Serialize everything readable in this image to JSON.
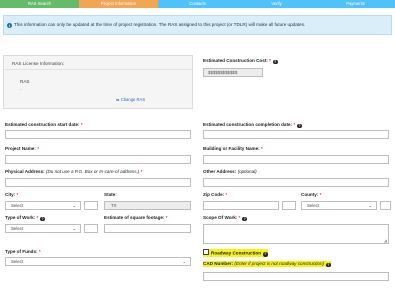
{
  "steps": [
    {
      "label": "RAS Search",
      "color": "#66bb6a"
    },
    {
      "label": "Project Information",
      "color": "#f2a653"
    },
    {
      "label": "Contacts",
      "color": "#4fc3f7"
    },
    {
      "label": "Verify",
      "color": "#4fc3f7"
    },
    {
      "label": "Payments",
      "color": "#4fc3f7"
    }
  ],
  "info_text": "This information can only be updated at the time of project registration. The RAS assigned to this project (or TDLR) will make all future updates.",
  "ras": {
    "title": "RAS License Information:",
    "name": "RAS",
    "change_link": "Change RAS"
  },
  "form": {
    "est_cost_label": "Estimated Construction Cost:",
    "est_cost_value": "$$$$$$$$$$$$",
    "start_date_label": "Estimated construction start date:",
    "completion_date_label": "Estimated construction completion date:",
    "project_name_label": "Project Name:",
    "building_name_label": "Building or Facility Name:",
    "physical_address_label": "Physical Address:",
    "physical_address_note": "(Do not use a P.O. Box or In-care-of address.)",
    "other_address_label": "Other Address:",
    "other_address_note": "(optional)",
    "city_label": "City:",
    "city_value": "Select",
    "state_label": "State:",
    "state_value": "TX",
    "zip_label": "Zip Code:",
    "county_label": "County:",
    "county_value": "Select",
    "type_of_work_label": "Type of Work:",
    "type_of_work_value": "Select",
    "sq_footage_label": "Estimate of square footage:",
    "scope_of_work_label": "Scope Of Work:",
    "type_of_funds_label": "Type of Funds:",
    "type_of_funds_value": "Select",
    "roadway_label": "Roadway Construction",
    "cad_label": "CAD Number:",
    "cad_note": "(Enter if project is not roadway construction)",
    "required_mark": "*",
    "help_glyph": "?"
  }
}
